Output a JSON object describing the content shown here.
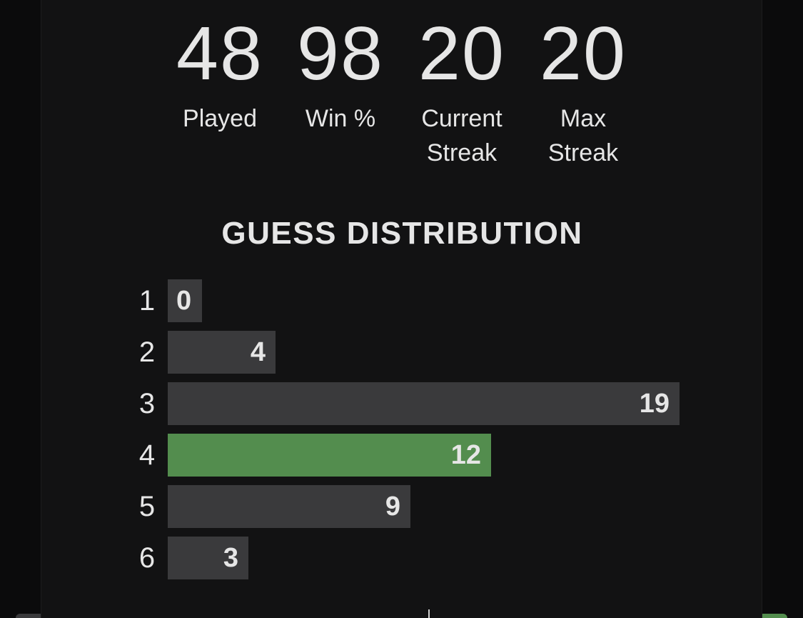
{
  "stats": [
    {
      "value": "48",
      "label": "Played"
    },
    {
      "value": "98",
      "label": "Win %"
    },
    {
      "value": "20",
      "label": "Current Streak"
    },
    {
      "value": "20",
      "label": "Max Streak"
    }
  ],
  "distribution": {
    "title": "GUESS DISTRIBUTION",
    "rows": [
      {
        "guess": "1",
        "count": 0,
        "highlight": false
      },
      {
        "guess": "2",
        "count": 4,
        "highlight": false
      },
      {
        "guess": "3",
        "count": 19,
        "highlight": false
      },
      {
        "guess": "4",
        "count": 12,
        "highlight": true
      },
      {
        "guess": "5",
        "count": 9,
        "highlight": false
      },
      {
        "guess": "6",
        "count": 3,
        "highlight": false
      }
    ]
  },
  "colors": {
    "background": "#121213",
    "bar": "#3a3a3c",
    "highlight": "#538d4e",
    "text": "#e6e6e6"
  }
}
